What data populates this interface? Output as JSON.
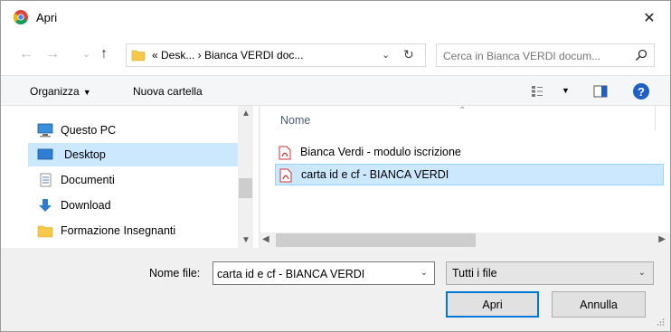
{
  "window": {
    "title": "Apri",
    "close_glyph": "✕"
  },
  "navigation": {
    "back_glyph": "←",
    "forward_glyph": "→",
    "recent_glyph": "⌄",
    "up_glyph": "↑",
    "address_path": "«  Desk...  ›  Bianca VERDI doc...",
    "address_dropdown_glyph": "⌄",
    "refresh_glyph": "↻",
    "search_placeholder": "Cerca in Bianca VERDI docum..."
  },
  "toolbar": {
    "organize_label": "Organizza",
    "organize_caret": "▼",
    "new_folder_label": "Nuova cartella",
    "view_caret": "▼",
    "help_label": "?"
  },
  "sidebar": {
    "items": [
      {
        "label": "Questo PC",
        "icon": "computer-icon"
      },
      {
        "label": "Desktop",
        "icon": "desktop-icon",
        "selected": true
      },
      {
        "label": "Documenti",
        "icon": "documents-icon"
      },
      {
        "label": "Download",
        "icon": "download-icon"
      },
      {
        "label": "Formazione Insegnanti",
        "icon": "folder-icon"
      }
    ]
  },
  "scroll_glyphs": {
    "up": "▲",
    "down": "▼",
    "left": "◀",
    "right": "▶",
    "sort": "⌃"
  },
  "file_list": {
    "column_name": "Nome",
    "files": [
      {
        "name": "Bianca Verdi - modulo iscrizione",
        "icon": "pdf-icon"
      },
      {
        "name": "carta id e cf - BIANCA VERDI",
        "icon": "pdf-icon",
        "selected": true
      }
    ]
  },
  "footer": {
    "filename_label": "Nome file:",
    "filename_value": "carta id e cf - BIANCA VERDI",
    "filename_caret": "⌄",
    "filter_value": "Tutti i file",
    "filter_caret": "⌄",
    "open_label": "Apri",
    "cancel_label": "Annulla"
  },
  "colors": {
    "accent": "#0078d7",
    "selection": "#cce8ff",
    "help": "#1e60c6",
    "pdf": "#d0312d",
    "folder": "#f7c84a"
  }
}
